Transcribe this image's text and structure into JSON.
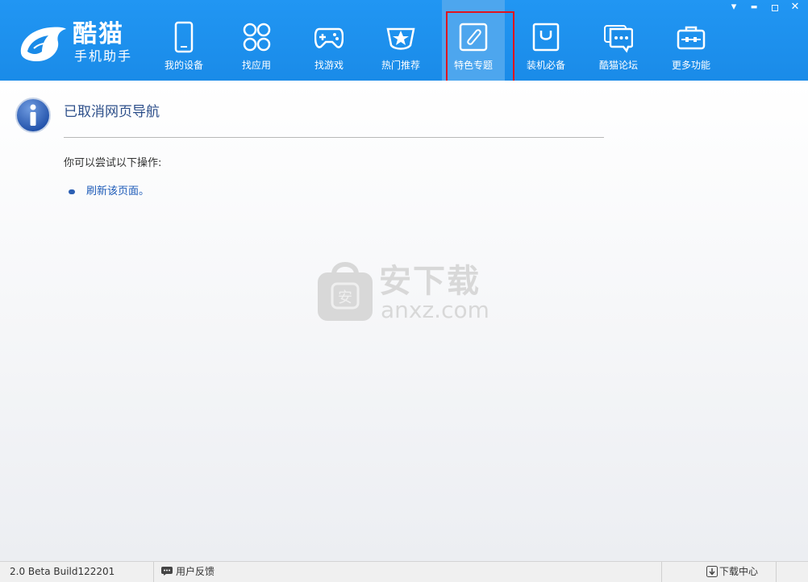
{
  "app": {
    "brand_name": "酷猫",
    "brand_subtitle": "手机助手"
  },
  "window_controls": {
    "menu": "▾",
    "minimize": "▬",
    "maximize": "▫",
    "close": "✕"
  },
  "nav": {
    "active": "特色专题",
    "items": [
      {
        "label": "我的设备",
        "icon": "phone-icon"
      },
      {
        "label": "找应用",
        "icon": "apps-grid-icon"
      },
      {
        "label": "找游戏",
        "icon": "gamepad-icon"
      },
      {
        "label": "热门推荐",
        "icon": "star-badge-icon"
      },
      {
        "label": "特色专题",
        "icon": "paperclip-icon"
      },
      {
        "label": "装机必备",
        "icon": "shopping-bag-icon"
      },
      {
        "label": "酷猫论坛",
        "icon": "chat-bubbles-icon"
      },
      {
        "label": "更多功能",
        "icon": "toolbox-icon"
      }
    ]
  },
  "content": {
    "error_title": "已取消网页导航",
    "try_text": "你可以尝试以下操作:",
    "refresh_link": "刷新该页面。",
    "watermark_cn": "安下载",
    "watermark_en": "anxz.com",
    "watermark_badge": "安"
  },
  "status_bar": {
    "version": "2.0 Beta Build122201",
    "feedback_label": "用户反馈",
    "download_label": "下载中心"
  },
  "colors": {
    "topbar": "#1a8be8",
    "nav_active": "#4da6ee",
    "highlight_box": "#e0141e",
    "link": "#1d5bb8"
  }
}
